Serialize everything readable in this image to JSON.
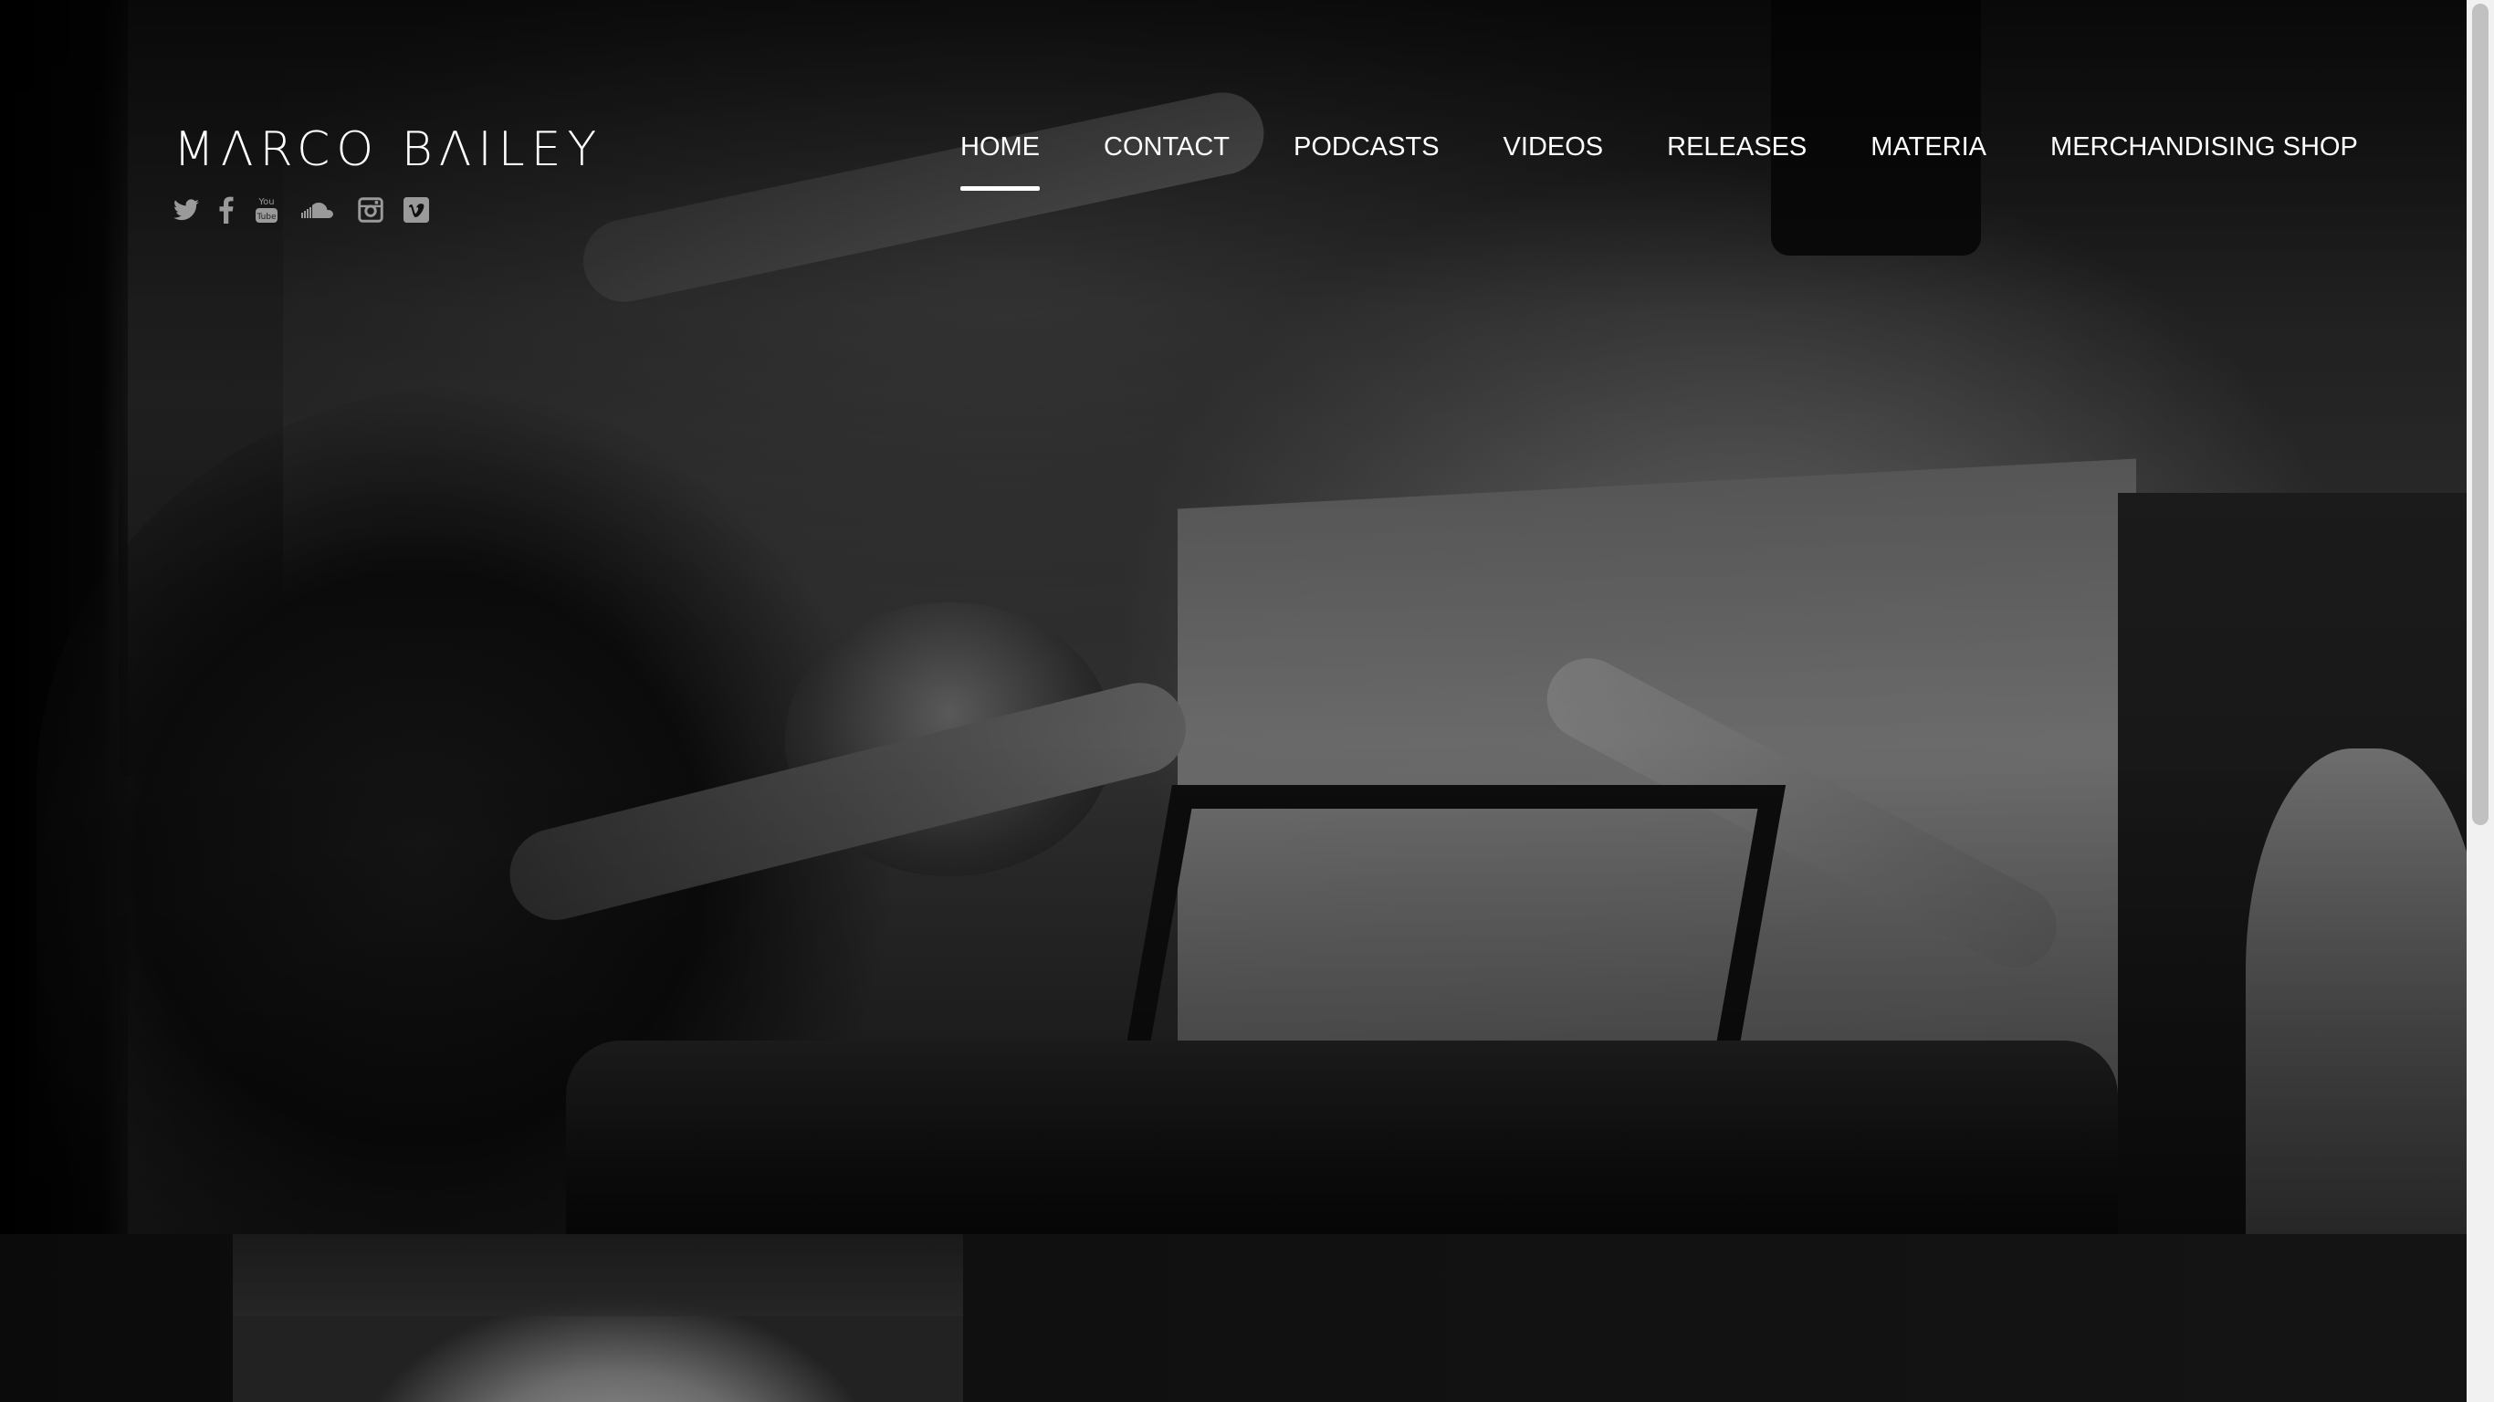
{
  "site": {
    "logo_text": "MΛRCO BΛILEY"
  },
  "social": [
    {
      "name": "twitter",
      "icon": "twitter-icon"
    },
    {
      "name": "facebook",
      "icon": "facebook-icon"
    },
    {
      "name": "youtube",
      "icon": "youtube-icon"
    },
    {
      "name": "soundcloud",
      "icon": "soundcloud-icon"
    },
    {
      "name": "instagram",
      "icon": "instagram-icon"
    },
    {
      "name": "vimeo",
      "icon": "vimeo-icon"
    }
  ],
  "nav": {
    "active": "HOME",
    "items": [
      {
        "label": "HOME"
      },
      {
        "label": "CONTACT"
      },
      {
        "label": "PODCASTS"
      },
      {
        "label": "VIDEOS"
      },
      {
        "label": "RELEASES"
      },
      {
        "label": "MATERIA"
      },
      {
        "label": "MERCHANDISING SHOP"
      }
    ]
  },
  "colors": {
    "nav_text": "#ffffff",
    "social_icons": "#9a9a9a",
    "background": "#050505"
  }
}
